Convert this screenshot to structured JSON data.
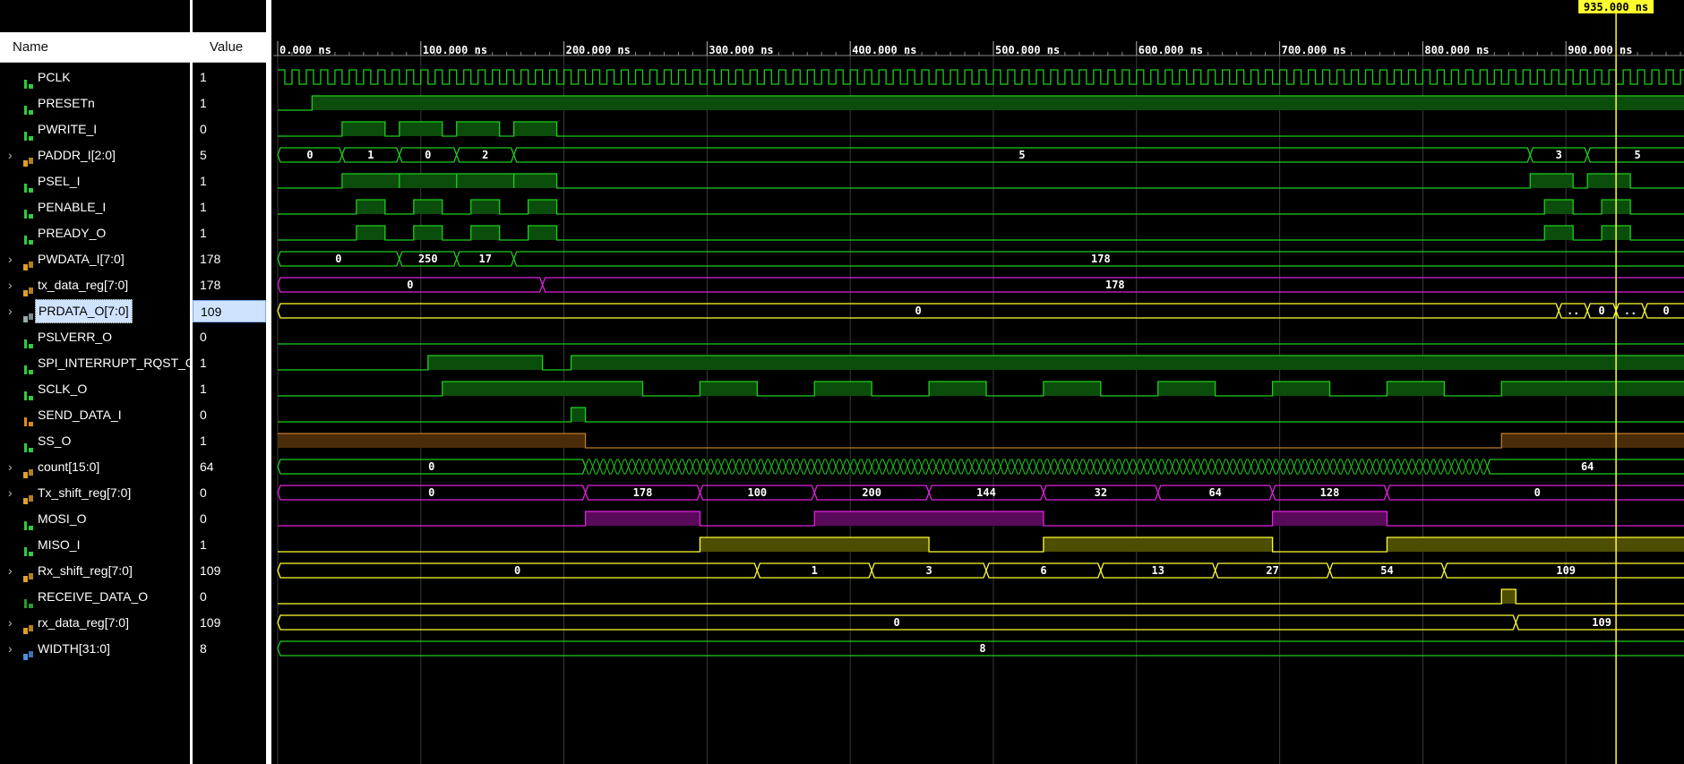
{
  "headers": {
    "name": "Name",
    "value": "Value"
  },
  "cursor": {
    "label": "935.000 ns",
    "time": 935
  },
  "timeline": {
    "start": 0,
    "end": 985,
    "unit": "ns",
    "ticks": [
      {
        "t": 0,
        "label": "0.000 ns"
      },
      {
        "t": 100,
        "label": "100.000 ns"
      },
      {
        "t": 200,
        "label": "200.000 ns"
      },
      {
        "t": 300,
        "label": "300.000 ns"
      },
      {
        "t": 400,
        "label": "400.000 ns"
      },
      {
        "t": 500,
        "label": "500.000 ns"
      },
      {
        "t": 600,
        "label": "600.000 ns"
      },
      {
        "t": 700,
        "label": "700.000 ns"
      },
      {
        "t": 800,
        "label": "800.000 ns"
      },
      {
        "t": 900,
        "label": "900.000 ns"
      }
    ]
  },
  "colors": {
    "green": "#1ecc1e",
    "greenFill": "#0b4e0b",
    "magenta": "#e020e0",
    "magentaFill": "#5a0a5a",
    "yellow": "#ffff30",
    "yellowFill": "#4e4e00",
    "orange": "#c07a2a",
    "orangeFill": "#4a2c08",
    "grid": "#3a3a3a"
  },
  "signals": [
    {
      "name": "PCLK",
      "value": "1",
      "kind": "clock",
      "color": "green",
      "icon": "bit-icon",
      "period": 10,
      "high_first": true
    },
    {
      "name": "PRESETn",
      "value": "1",
      "kind": "bit",
      "color": "green",
      "icon": "bit-icon",
      "edges": [
        [
          0,
          0
        ],
        [
          24,
          1
        ]
      ]
    },
    {
      "name": "PWRITE_I",
      "value": "0",
      "kind": "bit",
      "color": "green",
      "icon": "bit-icon",
      "edges": [
        [
          0,
          0
        ],
        [
          45,
          1
        ],
        [
          75,
          0
        ],
        [
          85,
          1
        ],
        [
          115,
          0
        ],
        [
          125,
          1
        ],
        [
          155,
          0
        ],
        [
          165,
          1
        ],
        [
          195,
          0
        ]
      ]
    },
    {
      "name": "PADDR_I[2:0]",
      "value": "5",
      "kind": "bus",
      "color": "green",
      "icon": "bus-icon",
      "expand": true,
      "segs": [
        [
          0,
          "0"
        ],
        [
          45,
          "1"
        ],
        [
          85,
          "0"
        ],
        [
          125,
          "2"
        ],
        [
          165,
          "5"
        ],
        [
          875,
          "3"
        ],
        [
          915,
          "5"
        ]
      ]
    },
    {
      "name": "PSEL_I",
      "value": "1",
      "kind": "bit",
      "color": "green",
      "icon": "bit-icon",
      "edges": [
        [
          0,
          0
        ],
        [
          45,
          1
        ],
        [
          85,
          0
        ],
        [
          85,
          1
        ],
        [
          125,
          0
        ],
        [
          125,
          1
        ],
        [
          165,
          0
        ],
        [
          165,
          1
        ],
        [
          195,
          0
        ],
        [
          875,
          1
        ],
        [
          905,
          0
        ],
        [
          915,
          1
        ],
        [
          945,
          0
        ]
      ]
    },
    {
      "name": "PENABLE_I",
      "value": "1",
      "kind": "bit",
      "color": "green",
      "icon": "bit-icon",
      "edges": [
        [
          0,
          0
        ],
        [
          55,
          1
        ],
        [
          75,
          0
        ],
        [
          95,
          1
        ],
        [
          115,
          0
        ],
        [
          135,
          1
        ],
        [
          155,
          0
        ],
        [
          175,
          1
        ],
        [
          195,
          0
        ],
        [
          885,
          1
        ],
        [
          905,
          0
        ],
        [
          925,
          1
        ],
        [
          945,
          0
        ]
      ]
    },
    {
      "name": "PREADY_O",
      "value": "1",
      "kind": "bit",
      "color": "green",
      "icon": "bit-icon",
      "edges": [
        [
          0,
          0
        ],
        [
          55,
          1
        ],
        [
          75,
          0
        ],
        [
          95,
          1
        ],
        [
          115,
          0
        ],
        [
          135,
          1
        ],
        [
          155,
          0
        ],
        [
          175,
          1
        ],
        [
          195,
          0
        ],
        [
          885,
          1
        ],
        [
          905,
          0
        ],
        [
          925,
          1
        ],
        [
          945,
          0
        ]
      ]
    },
    {
      "name": "PWDATA_I[7:0]",
      "value": "178",
      "kind": "bus",
      "color": "green",
      "icon": "bus-icon",
      "expand": true,
      "segs": [
        [
          0,
          "0"
        ],
        [
          85,
          "250"
        ],
        [
          125,
          "17"
        ],
        [
          165,
          "178"
        ]
      ]
    },
    {
      "name": "tx_data_reg[7:0]",
      "value": "178",
      "kind": "bus",
      "color": "magenta",
      "icon": "bus-icon",
      "expand": true,
      "segs": [
        [
          0,
          "0"
        ],
        [
          185,
          "178"
        ]
      ]
    },
    {
      "name": "PRDATA_O[7:0]",
      "value": "109",
      "kind": "bus",
      "color": "yellow",
      "icon": "bus-gray-icon",
      "expand": true,
      "selected": true,
      "segs": [
        [
          0,
          "0"
        ],
        [
          895,
          ".."
        ],
        [
          915,
          "0"
        ],
        [
          935,
          ".."
        ],
        [
          955,
          "0"
        ]
      ]
    },
    {
      "name": "PSLVERR_O",
      "value": "0",
      "kind": "bit",
      "color": "green",
      "icon": "bit-icon",
      "edges": [
        [
          0,
          0
        ]
      ]
    },
    {
      "name": "SPI_INTERRUPT_RQST_O",
      "value": "1",
      "kind": "bit",
      "color": "green",
      "icon": "bit-icon",
      "edges": [
        [
          0,
          0
        ],
        [
          105,
          1
        ],
        [
          185,
          0
        ],
        [
          205,
          1
        ]
      ]
    },
    {
      "name": "SCLK_O",
      "value": "1",
      "kind": "sclk",
      "color": "green",
      "icon": "bit-icon",
      "edges": [
        [
          0,
          0
        ],
        [
          115,
          1
        ],
        [
          255,
          0
        ],
        [
          295,
          1
        ],
        [
          335,
          0
        ],
        [
          375,
          1
        ],
        [
          415,
          0
        ],
        [
          455,
          1
        ],
        [
          495,
          0
        ],
        [
          535,
          1
        ],
        [
          575,
          0
        ],
        [
          615,
          1
        ],
        [
          655,
          0
        ],
        [
          695,
          1
        ],
        [
          735,
          0
        ],
        [
          775,
          1
        ],
        [
          815,
          0
        ],
        [
          855,
          1
        ]
      ]
    },
    {
      "name": "SEND_DATA_I",
      "value": "0",
      "kind": "bit",
      "color": "green",
      "icon": "bit-orange-icon",
      "edges": [
        [
          0,
          0
        ],
        [
          205,
          1
        ],
        [
          215,
          0
        ]
      ]
    },
    {
      "name": "SS_O",
      "value": "1",
      "kind": "bit",
      "color": "orange",
      "icon": "bit-icon",
      "edges": [
        [
          0,
          1
        ],
        [
          215,
          0
        ],
        [
          855,
          1
        ]
      ]
    },
    {
      "name": "count[15:0]",
      "value": "64",
      "kind": "bus",
      "color": "green",
      "icon": "bus-icon",
      "expand": true,
      "segs": [
        [
          0,
          "0"
        ],
        [
          215,
          "~"
        ],
        [
          845,
          "64"
        ]
      ]
    },
    {
      "name": "Tx_shift_reg[7:0]",
      "value": "0",
      "kind": "bus",
      "color": "magenta",
      "icon": "bus-icon",
      "expand": true,
      "segs": [
        [
          0,
          "0"
        ],
        [
          215,
          "178"
        ],
        [
          295,
          "100"
        ],
        [
          375,
          "200"
        ],
        [
          455,
          "144"
        ],
        [
          535,
          "32"
        ],
        [
          615,
          "64"
        ],
        [
          695,
          "128"
        ],
        [
          775,
          "0"
        ]
      ]
    },
    {
      "name": "MOSI_O",
      "value": "0",
      "kind": "bit",
      "color": "magenta",
      "icon": "bit-icon",
      "edges": [
        [
          0,
          0
        ],
        [
          215,
          1
        ],
        [
          295,
          0
        ],
        [
          375,
          1
        ],
        [
          535,
          0
        ],
        [
          695,
          1
        ],
        [
          775,
          0
        ]
      ]
    },
    {
      "name": "MISO_I",
      "value": "1",
      "kind": "bit",
      "color": "yellow",
      "icon": "bit-icon",
      "edges": [
        [
          0,
          0
        ],
        [
          295,
          1
        ],
        [
          455,
          0
        ],
        [
          535,
          1
        ],
        [
          695,
          0
        ],
        [
          775,
          1
        ]
      ]
    },
    {
      "name": "Rx_shift_reg[7:0]",
      "value": "109",
      "kind": "bus",
      "color": "yellow",
      "icon": "bus-icon",
      "expand": true,
      "segs": [
        [
          0,
          "0"
        ],
        [
          335,
          "1"
        ],
        [
          415,
          "3"
        ],
        [
          495,
          "6"
        ],
        [
          575,
          "13"
        ],
        [
          655,
          "27"
        ],
        [
          735,
          "54"
        ],
        [
          815,
          "109"
        ]
      ]
    },
    {
      "name": "RECEIVE_DATA_O",
      "value": "0",
      "kind": "bit",
      "color": "yellow",
      "icon": "bit-dark-icon",
      "edges": [
        [
          0,
          0
        ],
        [
          855,
          1
        ],
        [
          865,
          0
        ]
      ]
    },
    {
      "name": "rx_data_reg[7:0]",
      "value": "109",
      "kind": "bus",
      "color": "yellow",
      "icon": "bus-icon",
      "expand": true,
      "segs": [
        [
          0,
          "0"
        ],
        [
          865,
          "109"
        ]
      ]
    },
    {
      "name": "WIDTH[31:0]",
      "value": "8",
      "kind": "bus",
      "color": "green",
      "icon": "bus-blue-icon",
      "expand": true,
      "segs": [
        [
          0,
          "8"
        ]
      ]
    }
  ]
}
